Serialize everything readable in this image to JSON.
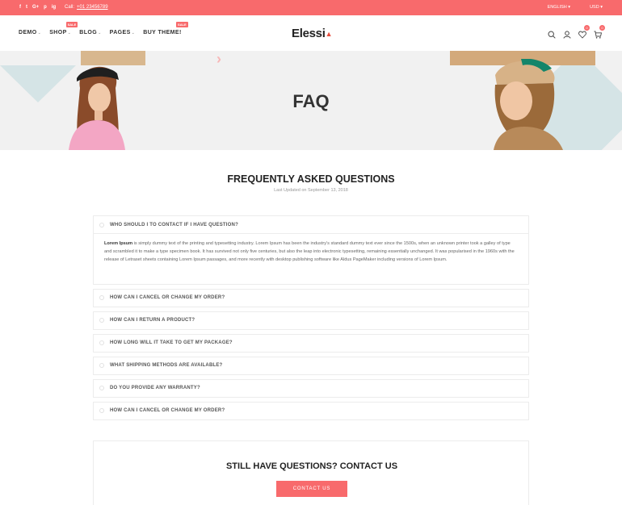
{
  "topbar": {
    "social": [
      "f",
      "t",
      "G+",
      "p",
      "ig"
    ],
    "call_label": "Call:",
    "phone": "+01 23456789",
    "language": "ENGLISH",
    "currency": "USD"
  },
  "header": {
    "nav": [
      {
        "label": "DEMO",
        "badge": ""
      },
      {
        "label": "SHOP",
        "badge": "SALE"
      },
      {
        "label": "BLOG",
        "badge": ""
      },
      {
        "label": "PAGES",
        "badge": ""
      },
      {
        "label": "BUY THEME!",
        "badge": "SALE"
      }
    ],
    "logo": "Elessi",
    "wishlist_count": "0",
    "cart_count": "0"
  },
  "banner": {
    "title": "FAQ"
  },
  "faq_section": {
    "title": "FREQUENTLY ASKED QUESTIONS",
    "updated": "Last Updated on September 13, 2018",
    "items": [
      {
        "q": "WHO SHOULD I TO CONTACT IF I HAVE QUESTION?"
      },
      {
        "q": "HOW CAN I CANCEL OR CHANGE MY ORDER?"
      },
      {
        "q": "HOW CAN I RETURN A PRODUCT?"
      },
      {
        "q": "HOW LONG WILL IT TAKE TO GET MY PACKAGE?"
      },
      {
        "q": "WHAT SHIPPING METHODS ARE AVAILABLE?"
      },
      {
        "q": "DO YOU PROVIDE ANY WARRANTY?"
      },
      {
        "q": "HOW CAN I CANCEL OR CHANGE MY ORDER?"
      }
    ],
    "answer_lead": "Lorem Ipsum",
    "answer_text": " is simply dummy text of the printing and typesetting industry. Lorem Ipsum has been the industry's standard dummy text ever since the 1500s, when an unknown printer took a galley of type and scrambled it to make a type specimen book. It has survived not only five centuries, but also the leap into electronic typesetting, remaining essentially unchanged. It was popularised in the 1960s with the release of Letraset sheets containing Lorem Ipsum passages, and more recently with desktop publishing software like Aldus PageMaker including versions of Lorem Ipsum."
  },
  "contact": {
    "title": "STILL HAVE QUESTIONS? CONTACT US",
    "button": "CONTACT US"
  },
  "colors": {
    "accent": "#f86a6c",
    "banner_bg": "#f1f1f1",
    "shape": "#d5e4e6"
  }
}
